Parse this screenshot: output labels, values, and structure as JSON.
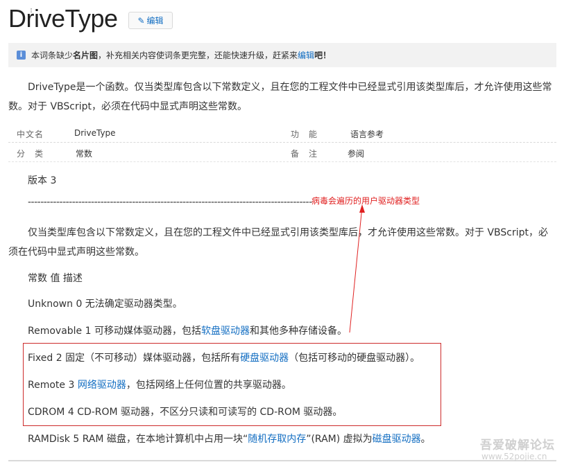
{
  "title": "DriveType",
  "edit_label": "编辑",
  "notice": {
    "part1": "本词条缺少",
    "bold": "名片图",
    "part2": "，补充相关内容使词条更完整，还能快速升级，赶紧来",
    "link": "编辑",
    "part3": "吧！"
  },
  "intro": "DriveType是一个函数。仅当类型库包含以下常数定义，且在您的工程文件中已经显式引用该类型库后，才允许使用这些常数。对于 VBScript，必须在代码中显式声明这些常数。",
  "infobox": {
    "row1": {
      "label1": "中文名",
      "value1": "DriveType",
      "label2": "功　能",
      "value2": "语言参考"
    },
    "row2": {
      "label1": "分　类",
      "value1": "常数",
      "label2": "备　注",
      "value2": "参阅"
    }
  },
  "version": "版本 3",
  "dashes": "------------------------------------------------------------------------------------------",
  "annotation": "病毒会遍历的用户驱动器类型",
  "para2": "仅当类型库包含以下常数定义，且在您的工程文件中已经显式引用该类型库后，才允许使用这些常数。对于 VBScript，必须在代码中显式声明这些常数。",
  "const_header": "常数 值 描述",
  "entries": {
    "unknown": "Unknown 0 无法确定驱动器类型。",
    "removable": {
      "pre": "Removable 1 可移动媒体驱动器，包括",
      "link": "软盘驱动器",
      "post": "和其他多种存储设备。"
    },
    "fixed": {
      "pre": "Fixed 2 固定（不可移动）媒体驱动器，包括所有",
      "link": "硬盘驱动器",
      "post": "（包括可移动的硬盘驱动器）。"
    },
    "remote": {
      "pre": "Remote 3 ",
      "link": "网络驱动器",
      "post": "，包括网络上任何位置的共享驱动器。"
    },
    "cdrom": "CDROM 4 CD-ROM 驱动器，不区分只读和可读写的 CD-ROM 驱动器。",
    "ramdisk": {
      "pre": "RAMDisk 5 RAM 磁盘，在本地计算机中占用一块“",
      "link1": "随机存取内存",
      "mid": "”(RAM) 虚拟为",
      "link2": "磁盘驱动器",
      "post": "。"
    }
  },
  "watermark": "吾爱破解论坛",
  "watermark_url": "www.52pojie.cn",
  "colors": {
    "link": "#136ec2",
    "annotation": "#e02020",
    "box": "#cc2a2a"
  },
  "icons": [
    "pencil-icon",
    "info-icon",
    "text-cursor-icon"
  ]
}
